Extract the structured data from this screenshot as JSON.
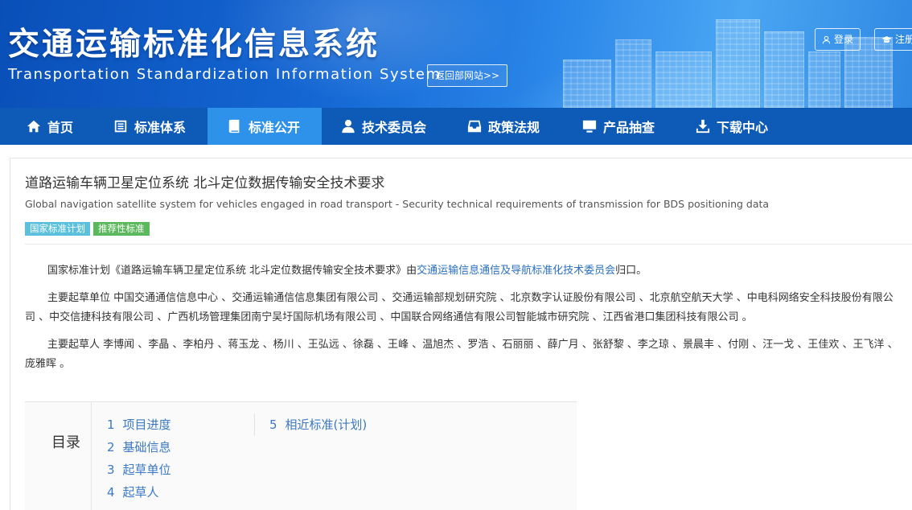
{
  "header": {
    "title_cn": "交通运输标准化信息系统",
    "title_en": "Transportation Standardization Information System",
    "back_label": "返回部网站>>",
    "login_label": "登录",
    "register_label": "注册"
  },
  "nav": {
    "items": [
      {
        "label": "首页",
        "icon": "home-icon"
      },
      {
        "label": "标准体系",
        "icon": "list-icon"
      },
      {
        "label": "标准公开",
        "icon": "book-icon",
        "active": true
      },
      {
        "label": "技术委员会",
        "icon": "user-icon"
      },
      {
        "label": "政策法规",
        "icon": "inbox-icon"
      },
      {
        "label": "产品抽查",
        "icon": "monitor-icon"
      },
      {
        "label": "下载中心",
        "icon": "download-icon"
      }
    ]
  },
  "doc": {
    "title": "道路运输车辆卫星定位系统 北斗定位数据传输安全技术要求",
    "title_en": "Global navigation satellite system for vehicles engaged in road transport - Security technical requirements of transmission for BDS positioning data",
    "tags": [
      "国家标准计划",
      "推荐性标准"
    ],
    "para1_prefix": "国家标准计划《道路运输车辆卫星定位系统 北斗定位数据传输安全技术要求》由",
    "para1_link": "交通运输信息通信及导航标准化技术委员会",
    "para1_suffix": "归口。",
    "para2": "主要起草单位 中国交通通信信息中心 、交通运输通信信息集团有限公司 、交通运输部规划研究院 、北京数字认证股份有限公司 、北京航空航天大学 、中电科网络安全科技股份有限公司 、中交信捷科技有限公司 、广西机场管理集团南宁吴圩国际机场有限公司 、中国联合网络通信有限公司智能城市研究院 、江西省港口集团科技有限公司 。",
    "para3": "主要起草人 李博闻 、李晶 、李柏丹 、蒋玉龙 、杨川 、王弘远 、徐磊 、王峰 、温旭杰 、罗浩 、石丽丽 、薛广月 、张舒黎 、李之琼 、景晨丰 、付刚 、汪一戈 、王佳欢 、王飞洋 、庞雅晖 。"
  },
  "toc": {
    "label": "目录",
    "col1": [
      {
        "num": "1",
        "label": "项目进度"
      },
      {
        "num": "2",
        "label": "基础信息"
      },
      {
        "num": "3",
        "label": "起草单位"
      },
      {
        "num": "4",
        "label": "起草人"
      }
    ],
    "col2": [
      {
        "num": "5",
        "label": "相近标准(计划)"
      }
    ]
  }
}
